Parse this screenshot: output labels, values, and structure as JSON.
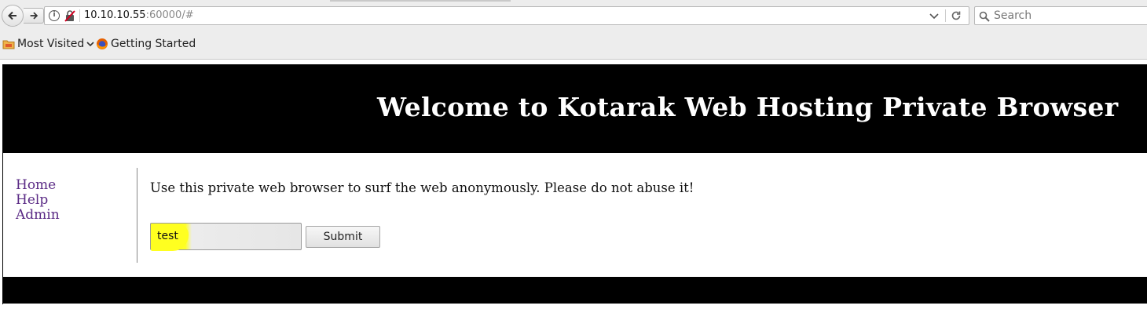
{
  "browser": {
    "url_host": "10.10.10.55",
    "url_rest": ":60000/#",
    "search_placeholder": "Search",
    "bookmarks": [
      {
        "label": "Most Visited",
        "icon": "folder-icon"
      },
      {
        "label": "Getting Started",
        "icon": "firefox-icon"
      }
    ]
  },
  "page": {
    "title": "Welcome to Kotarak Web Hosting Private Browser",
    "nav": [
      {
        "label": "Home"
      },
      {
        "label": "Help"
      },
      {
        "label": "Admin"
      }
    ],
    "intro": "Use this private web browser to surf the web anonymously. Please do not abuse it!",
    "input_value": "test",
    "submit_label": "Submit",
    "colors": {
      "header_bg": "#000000",
      "link": "#5a2a85",
      "highlight": "#ffff20"
    }
  }
}
